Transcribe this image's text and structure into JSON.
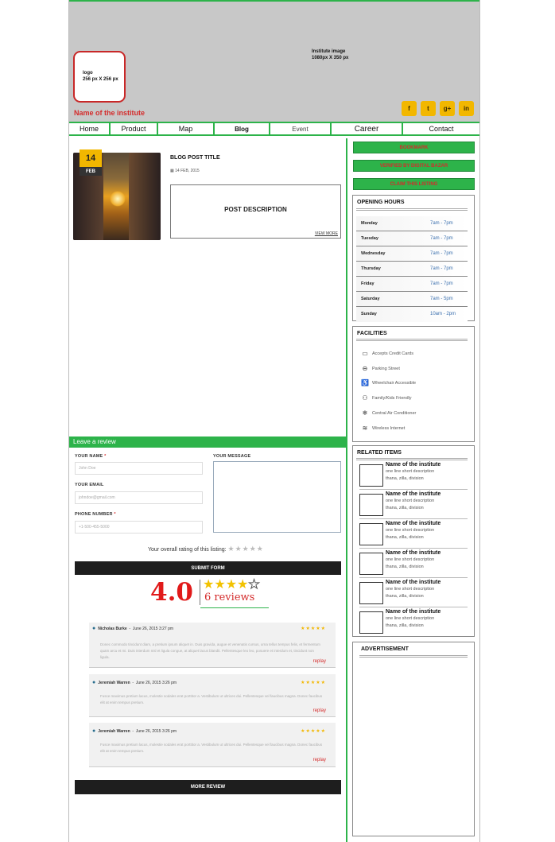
{
  "banner": {
    "image_text_line1": "Institute image",
    "image_text_line2": "1080px X 350 px"
  },
  "logo": {
    "line1": "logo",
    "line2": "256 px X 256 px"
  },
  "institute_name": "Name of the institute",
  "socials": [
    {
      "icon": "facebook-icon",
      "glyph": "f"
    },
    {
      "icon": "twitter-icon",
      "glyph": "t"
    },
    {
      "icon": "google-plus-icon",
      "glyph": "g+"
    },
    {
      "icon": "linkedin-icon",
      "glyph": "in"
    }
  ],
  "nav": [
    "Home",
    "Product",
    "Map",
    "Blog",
    "Event",
    "Career",
    "Contact"
  ],
  "blog": {
    "day": "14",
    "month": "FEB",
    "title": "BLOG POST TITLE",
    "date": "14 FEB, 2015",
    "description": "POST  DESCRIPTION",
    "view_more": "VIEW MORE"
  },
  "review_form": {
    "heading": "Leave a review",
    "name_label": "YOUR NAME",
    "name_placeholder": "John Doe",
    "email_label": "YOUR EMAIL",
    "email_placeholder": "johndoe@gmail.com",
    "phone_label": "PHONE NUMBER",
    "phone_placeholder": "+1-500-455-5000",
    "message_label": "YOUR MESSAGE",
    "rating_text": "Your overall rating of this listing:",
    "rating_stars": "★★★★★",
    "submit": "SUBMIT FORM"
  },
  "summary": {
    "score": "4.0",
    "stars_filled": "★★★★",
    "stars_empty": "★",
    "review_count": "6 reviews"
  },
  "reviews": [
    {
      "name": "Nicholas Burke",
      "date": "June 26, 2015 3:27 pm",
      "stars": "★★★★★",
      "body": "Donec commodo tincidunt diam, a pretium ipsum aliquet in. Duis gravida, augue et venenatis cursus, urna tellus tempus felis, et fermentum quam arcu et mi. Duis interdum nisl et ligula congue, at aliquet lacus blandit. Pellentesque leo leo, posuere et interdum et, tincidunt non ligula.",
      "reply": "replay"
    },
    {
      "name": "Jeremiah Warren",
      "date": "June 26, 2015 3:26 pm",
      "stars": "★★★★★",
      "body": "Fusce maximus pretium lacus, molestie sodales erat porttitor a. Vestibulum ut ultrices dui. Pellentesque vel faucibus magna. Donec faucibus elit at enim tempus pretium.",
      "reply": "replay"
    },
    {
      "name": "Jeremiah Warren",
      "date": "June 26, 2015 3:26 pm",
      "stars": "★★★★★",
      "body": "Fusce maximus pretium lacus, molestie sodales erat porttitor a. Vestibulum ut ultrices dui. Pellentesque vel faucibus magna. Donec faucibus elit at enim tempus pretium.",
      "reply": "replay"
    }
  ],
  "more_review": "MORE REVIEW",
  "sidebar": {
    "buttons": [
      "BOOKMARK",
      "VERIFIED BY DIGITAL BAZAR",
      "CLAIM THIS LISTING"
    ],
    "opening_hours": {
      "title": "OPENING HOURS",
      "rows": [
        {
          "day": "Monday",
          "time": "7am - 7pm"
        },
        {
          "day": "Tuesday",
          "time": "7am - 7pm"
        },
        {
          "day": "Wednesday",
          "time": "7am - 7pm"
        },
        {
          "day": "Thursday",
          "time": "7am - 7pm"
        },
        {
          "day": "Friday",
          "time": "7am - 7pm"
        },
        {
          "day": "Saturday",
          "time": "7am - 5pm"
        },
        {
          "day": "Sunday",
          "time": "10am - 2pm"
        }
      ]
    },
    "facilities": {
      "title": "FACILITIES",
      "items": [
        {
          "icon": "credit-card-icon",
          "glyph": "▭",
          "label": "Accepts Credit Cards"
        },
        {
          "icon": "car-icon",
          "glyph": "⊖",
          "label": "Parking Street"
        },
        {
          "icon": "wheelchair-icon",
          "glyph": "♿",
          "label": "Wheelchair Accessible"
        },
        {
          "icon": "family-icon",
          "glyph": "⚇",
          "label": "Family/Kids Friendly"
        },
        {
          "icon": "snowflake-icon",
          "glyph": "❄",
          "label": "Central Air Conditioner"
        },
        {
          "icon": "wifi-icon",
          "glyph": "≋",
          "label": "Wireless Internet"
        }
      ]
    },
    "related": {
      "title": "RELATED ITEMS",
      "items": [
        {
          "name": "Name of the institute",
          "desc": "one line short description",
          "loc": "thana, zilla, division"
        },
        {
          "name": "Name of the institute",
          "desc": "one line short description",
          "loc": "thana, zilla, division"
        },
        {
          "name": "Name of the institute",
          "desc": "one line short description",
          "loc": "thana, zilla, division"
        },
        {
          "name": "Name of the institute",
          "desc": "one line short description",
          "loc": "thana, zilla, division"
        },
        {
          "name": "Name of the institute",
          "desc": "one line short description",
          "loc": "thana, zilla, division"
        },
        {
          "name": "Name of the institute",
          "desc": "one line short description",
          "loc": "thana, zilla, division"
        }
      ]
    },
    "advertisement": "ADVERTISEMENT"
  }
}
